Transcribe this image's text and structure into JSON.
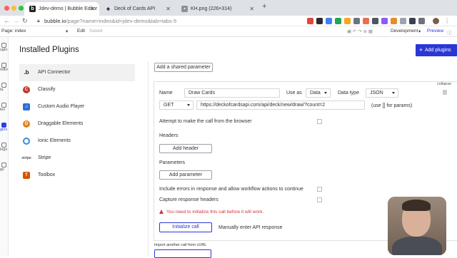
{
  "browser": {
    "tabs": [
      {
        "title": "Jdev-demo | Bubble Editor",
        "active": true
      },
      {
        "title": "Deck of Cards API",
        "active": false
      },
      {
        "title": "KH.png (226×314)",
        "active": false
      }
    ],
    "url_host": "bubble.io",
    "url_path": "/page?name=index&id=jdev-demo&tab=tabs-5"
  },
  "editor_toolbar": {
    "page_label": "Page: index",
    "edit_label": "Edit",
    "saved_label": "Saved",
    "dev_label": "Development",
    "preview_label": "Preview"
  },
  "rail": {
    "items": [
      "ugin",
      "rkflow",
      "ta",
      "les",
      "gins",
      "ings",
      "gs"
    ]
  },
  "header": {
    "title": "Installed Plugins",
    "add_plugins": "Add plugins"
  },
  "plugins": [
    {
      "name": "API Connector",
      "icon": ".b",
      "color": "#1d1d1d",
      "active": true
    },
    {
      "name": "Classify",
      "icon": "C",
      "color": "#c0392b",
      "active": false
    },
    {
      "name": "Custom Audio Player",
      "icon": "♫",
      "color": "#2b6fd6",
      "active": false
    },
    {
      "name": "Draggable Elements",
      "icon": "D",
      "color": "#e67e22",
      "active": false
    },
    {
      "name": "Ionic Elements",
      "icon": "I",
      "color": "#3a8de0",
      "active": false
    },
    {
      "name": "Stripe",
      "icon": "stripe",
      "color": "#555555",
      "active": false
    },
    {
      "name": "Toolbox",
      "icon": "T",
      "color": "#d35400",
      "active": false
    }
  ],
  "config": {
    "add_shared_param": "Add a shared parameter",
    "collapse": "collapse",
    "name_label": "Name",
    "name_value": "Draw Cards",
    "use_as_label": "Use as",
    "use_as_value": "Data",
    "data_type_label": "Data type",
    "data_type_value": "JSON",
    "method": "GET",
    "endpoint": "https://deckofcardsapi.com/api/deck/new/draw/?count=2",
    "params_hint": "(use [] for params)",
    "browser_call_label": "Attempt to make the call from the browser",
    "headers_label": "Headers",
    "add_header": "Add header",
    "parameters_label": "Parameters",
    "add_parameter": "Add parameter",
    "include_errors_label": "Include errors in response and allow workflow actions to continue",
    "capture_headers_label": "Capture response headers",
    "warning": "You need to initialize this call before it will work.",
    "initialize_button": "Initialize call",
    "manual_response": "Manually enter API response",
    "import_label": "Import another call from cURL"
  }
}
